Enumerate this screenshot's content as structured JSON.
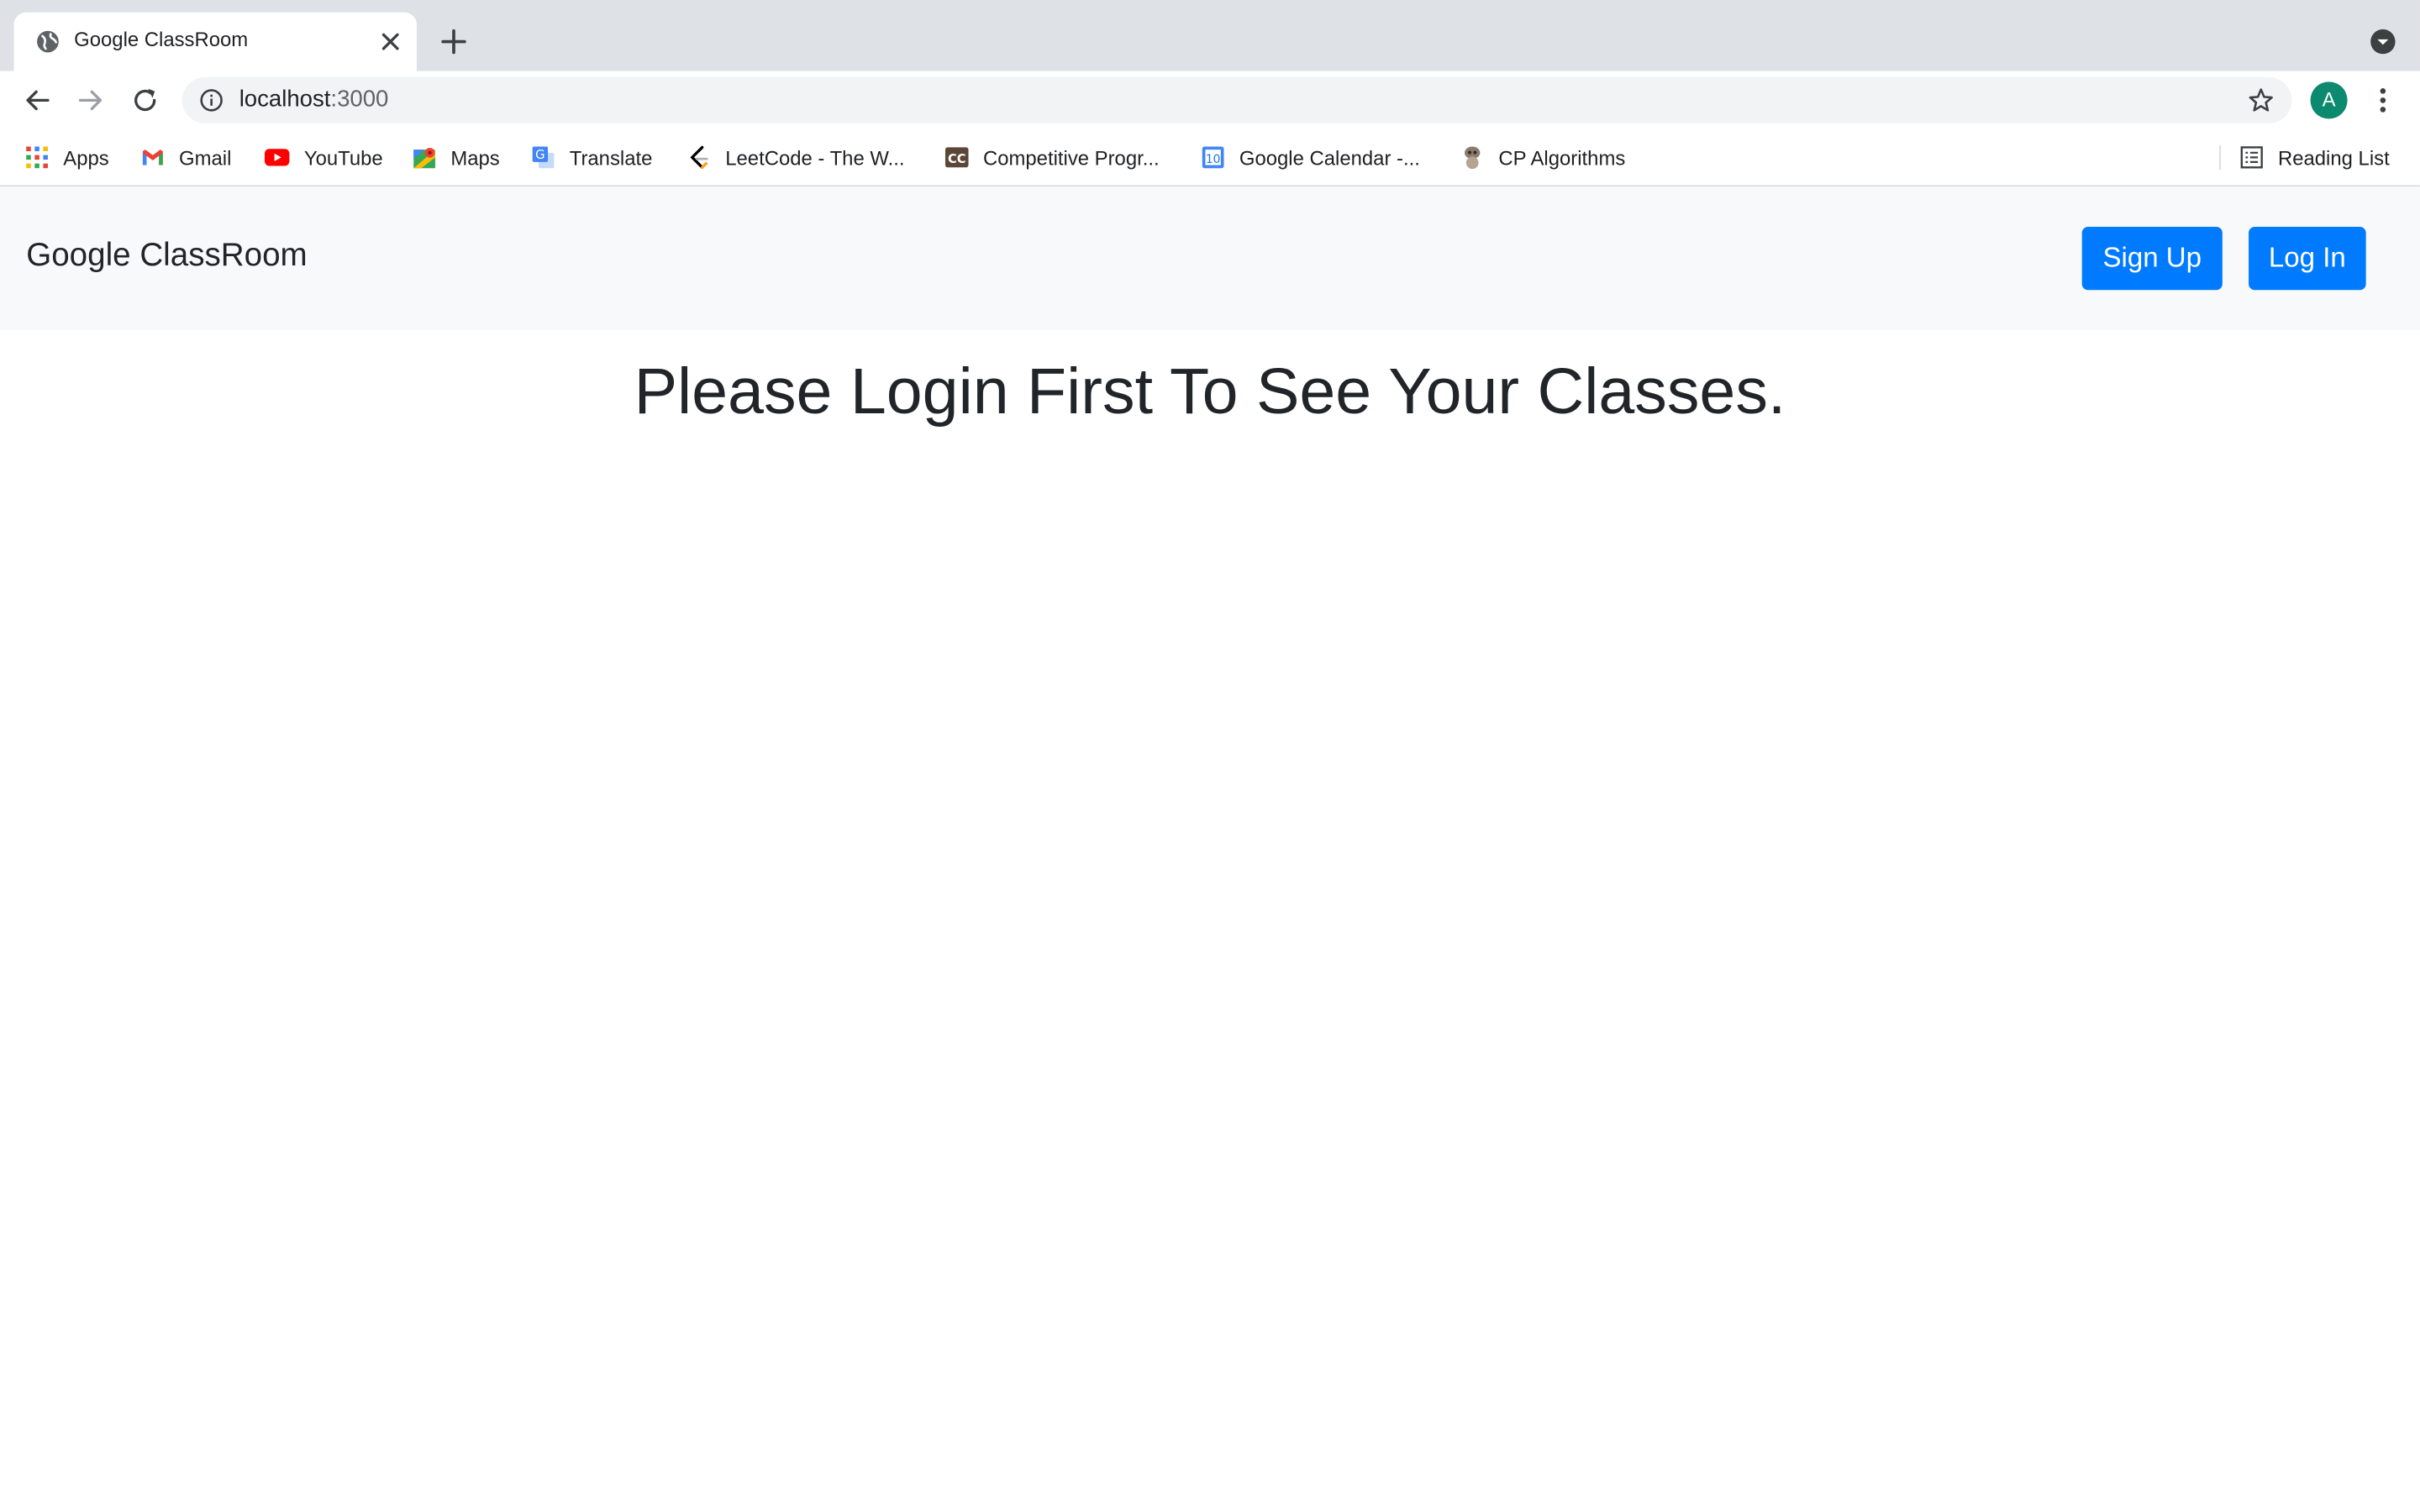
{
  "browser": {
    "tab": {
      "title": "Google ClassRoom"
    },
    "address_bar": {
      "host": "localhost",
      "port": ":3000"
    },
    "profile_initial": "A",
    "bookmarks": [
      {
        "label": "Apps",
        "icon": "apps-grid-icon"
      },
      {
        "label": "Gmail",
        "icon": "gmail-icon"
      },
      {
        "label": "YouTube",
        "icon": "youtube-icon"
      },
      {
        "label": "Maps",
        "icon": "maps-icon"
      },
      {
        "label": "Translate",
        "icon": "translate-icon"
      },
      {
        "label": "LeetCode - The W...",
        "icon": "leetcode-icon"
      },
      {
        "label": "Competitive Progr...",
        "icon": "codechef-icon"
      },
      {
        "label": "Google Calendar -...",
        "icon": "calendar-icon"
      },
      {
        "label": "CP Algorithms",
        "icon": "cp-algorithms-icon"
      }
    ],
    "reading_list_label": "Reading List"
  },
  "page": {
    "navbar": {
      "brand": "Google ClassRoom",
      "signup_label": "Sign Up",
      "login_label": "Log In"
    },
    "message": "Please Login First To See Your Classes."
  },
  "colors": {
    "primary_button": "#007bff",
    "navbar_bg": "#f8f9fa",
    "text": "#212529",
    "avatar": "#0b8a6f"
  }
}
